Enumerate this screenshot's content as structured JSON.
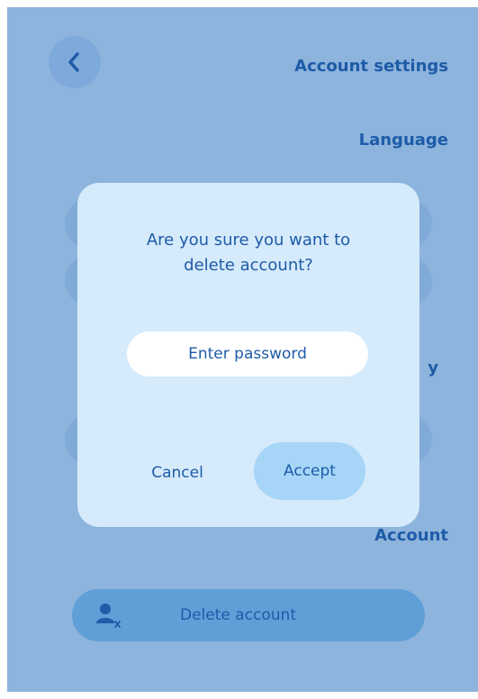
{
  "header": {
    "title": "Account settings",
    "back_icon": "chevron-left-icon"
  },
  "sections": {
    "language": "Language",
    "partial_heading_letter": "y",
    "account": "Account"
  },
  "delete_row": {
    "label": "Delete account",
    "icon": "user-remove-icon"
  },
  "dialog": {
    "message": "Are you sure you want to\ndelete account?",
    "password_placeholder": "Enter password",
    "cancel_label": "Cancel",
    "accept_label": "Accept"
  },
  "colors": {
    "text_primary": "#1e5ba8",
    "overlay_background": "#8db4dc",
    "dialog_background": "#d5eafb",
    "accept_button": "#a6d5f7",
    "delete_row": "#5f9fd8"
  }
}
